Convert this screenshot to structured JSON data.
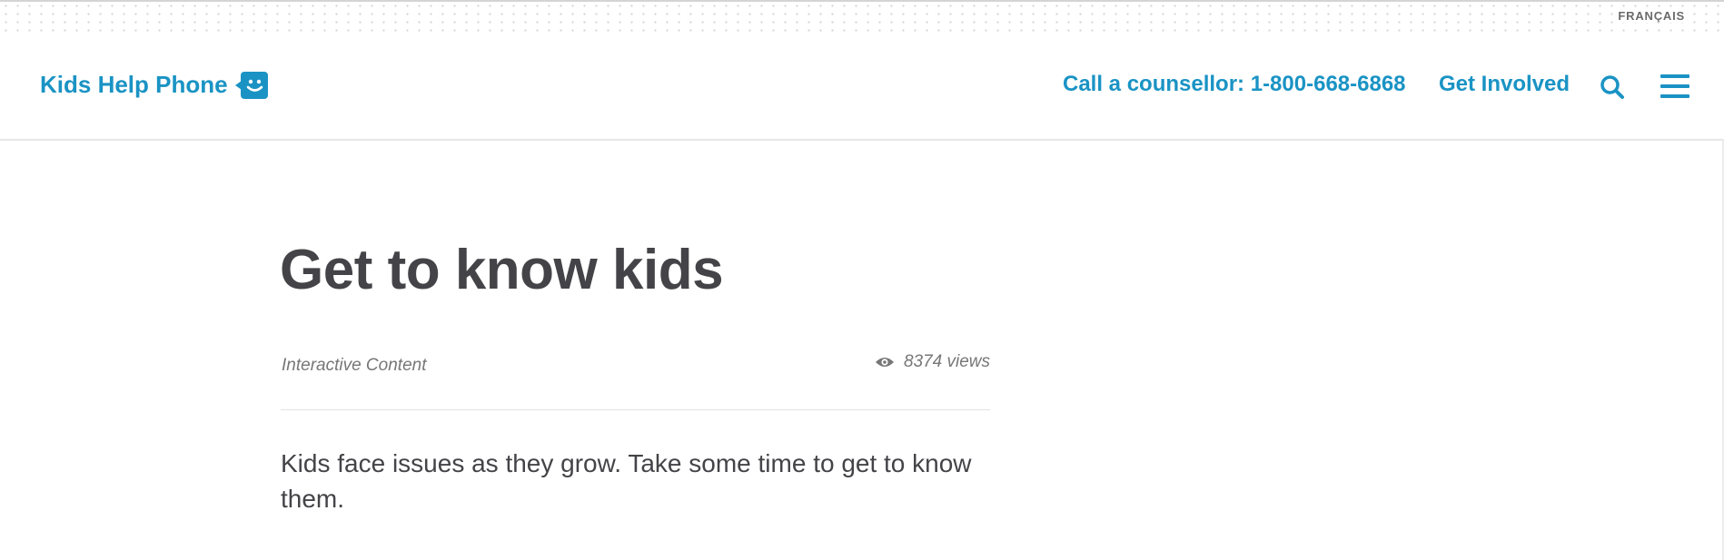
{
  "top_bar": {
    "language_link": "FRANÇAIS"
  },
  "header": {
    "logo_text": "Kids Help Phone",
    "call_link": "Call a counsellor: 1-800-668-6868",
    "involved_link": "Get Involved"
  },
  "icons": {
    "logo": "speech-bubble-smiley-icon",
    "search": "search-icon",
    "menu": "hamburger-menu-icon",
    "views": "eye-icon"
  },
  "article": {
    "title": "Get to know kids",
    "category": "Interactive Content",
    "views": "8374 views",
    "lead": "Kids face issues as they grow. Take some time to get to know them."
  },
  "colors": {
    "brand": "#1a93c4",
    "heading": "#444448",
    "muted": "#777777"
  }
}
